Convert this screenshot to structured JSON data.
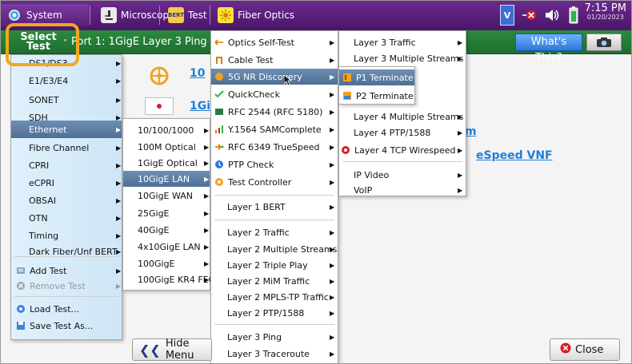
{
  "topbar": {
    "tabs": [
      {
        "label": "System",
        "icon": "gear-icon"
      },
      {
        "label": "Microscope",
        "icon": "microscope-icon"
      },
      {
        "label": "Test",
        "icon": "bert-icon",
        "icon_text": "BERT"
      },
      {
        "label": "Fiber Optics",
        "icon": "sun-icon"
      }
    ],
    "status": {
      "vnc": "V",
      "battery_icon": "battery-icon"
    },
    "time": "7:15 PM",
    "date": "01/20/2023"
  },
  "greenbar": {
    "select_line1": "Select",
    "select_line2": "Test",
    "port_title": "Port 1: 1GigE Layer 3 Ping T",
    "whats_this": "What's This?"
  },
  "workspace": {
    "links": [
      "10",
      "1Gi",
      "m",
      "eSpeed VNF"
    ]
  },
  "menu1": {
    "items": [
      {
        "label": "DS1/DS3",
        "arrow": true
      },
      {
        "label": "E1/E3/E4",
        "arrow": true
      },
      {
        "label": "SONET",
        "arrow": true
      },
      {
        "label": "SDH",
        "arrow": true
      },
      {
        "label": "Ethernet",
        "arrow": true,
        "selected": true
      },
      {
        "label": "Fibre Channel",
        "arrow": true
      },
      {
        "label": "CPRI",
        "arrow": true
      },
      {
        "label": "eCPRI",
        "arrow": true
      },
      {
        "label": "OBSAI",
        "arrow": true
      },
      {
        "label": "OTN",
        "arrow": true
      },
      {
        "label": "Timing",
        "arrow": true
      },
      {
        "label": "Dark Fiber/Unf BERT",
        "arrow": true
      },
      {
        "label": "Add Test",
        "arrow": true,
        "icon": "add-icon"
      },
      {
        "label": "Remove Test",
        "arrow": true,
        "icon": "remove-icon",
        "disabled": true
      },
      {
        "label": "Load Test...",
        "icon": "load-icon"
      },
      {
        "label": "Save Test As...",
        "icon": "save-icon"
      }
    ]
  },
  "menu2": {
    "items": [
      {
        "label": "10/100/1000"
      },
      {
        "label": "100M Optical"
      },
      {
        "label": "1GigE Optical"
      },
      {
        "label": "10GigE LAN",
        "selected": true
      },
      {
        "label": "10GigE WAN"
      },
      {
        "label": "25GigE"
      },
      {
        "label": "40GigE"
      },
      {
        "label": "4x10GigE LAN"
      },
      {
        "label": "100GigE"
      },
      {
        "label": "100GigE KR4 FEC"
      }
    ]
  },
  "menu3": {
    "items": [
      {
        "label": "Optics Self-Test",
        "icon": "optics-icon",
        "arrow": true
      },
      {
        "label": "Cable Test",
        "icon": "cable-icon",
        "arrow": true
      },
      {
        "label": "5G NR Discovery",
        "icon": "5g-icon",
        "arrow": true,
        "selected": true
      },
      {
        "label": "QuickCheck",
        "icon": "check-icon",
        "arrow": true
      },
      {
        "label": "RFC 2544 (RFC 5180)",
        "icon": "rfc-icon",
        "arrow": true
      },
      {
        "label": "Y.1564 SAMComplete",
        "icon": "bars-icon",
        "arrow": true
      },
      {
        "label": "RFC 6349 TrueSpeed",
        "icon": "truespeed-icon",
        "arrow": true
      },
      {
        "label": "PTP Check",
        "icon": "ptp-icon",
        "arrow": true
      },
      {
        "label": "Test Controller",
        "icon": "controller-icon",
        "arrow": true
      },
      {
        "label": "Layer 1 BERT",
        "arrow": true
      },
      {
        "label": "Layer 2 Traffic",
        "arrow": true
      },
      {
        "label": "Layer 2 Multiple Streams",
        "arrow": true
      },
      {
        "label": "Layer 2 Triple Play",
        "arrow": true
      },
      {
        "label": "Layer 2 MiM Traffic",
        "arrow": true
      },
      {
        "label": "Layer 2 MPLS-TP Traffic",
        "arrow": true
      },
      {
        "label": "Layer 2 PTP/1588",
        "arrow": true
      },
      {
        "label": "Layer 3 Ping",
        "arrow": true
      },
      {
        "label": "Layer 3 Traceroute",
        "arrow": true
      }
    ]
  },
  "menu4": {
    "items": [
      {
        "label": "Layer 3 Traffic",
        "arrow": true
      },
      {
        "label": "Layer 3 Multiple Streams",
        "arrow": true
      },
      {
        "label": "Layer 4 Multiple Streams",
        "arrow": true
      },
      {
        "label": "Layer 4 PTP/1588",
        "arrow": true
      },
      {
        "label": "Layer 4 TCP Wirespeed",
        "icon": "tcp-icon",
        "arrow": true
      },
      {
        "label": "IP Video",
        "arrow": true
      },
      {
        "label": "VoIP",
        "arrow": true
      }
    ]
  },
  "menu5": {
    "items": [
      {
        "label": "P1 Terminate",
        "icon": "p1-icon",
        "selected": true
      },
      {
        "label": "P2 Terminate",
        "icon": "p2-icon"
      }
    ]
  },
  "buttons": {
    "hide_menu": "Hide Menu",
    "close": "Close"
  }
}
